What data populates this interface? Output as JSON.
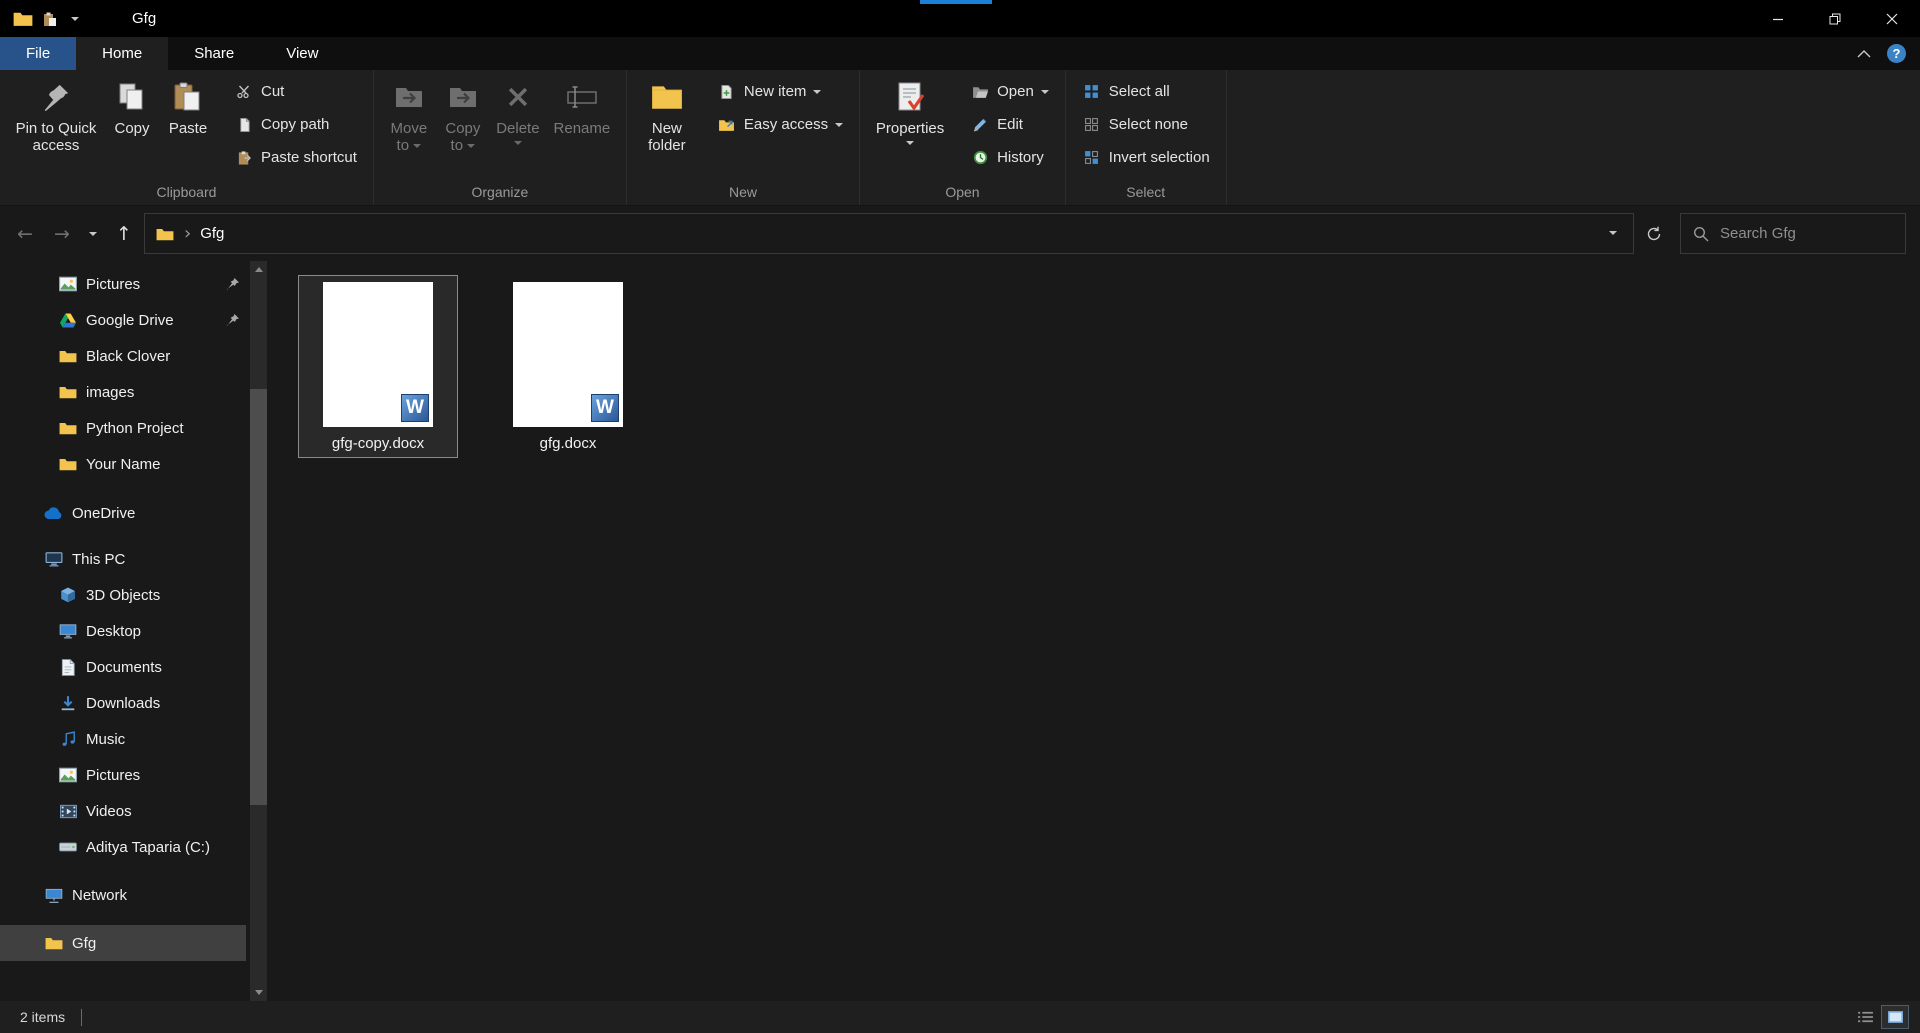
{
  "window": {
    "title": "Gfg"
  },
  "tabs": [
    "File",
    "Home",
    "Share",
    "View"
  ],
  "ribbon": {
    "clipboard": {
      "label": "Clipboard",
      "pin_to_quick_access": "Pin to Quick access",
      "copy": "Copy",
      "paste": "Paste",
      "cut": "Cut",
      "copy_path": "Copy path",
      "paste_shortcut": "Paste shortcut"
    },
    "organize": {
      "label": "Organize",
      "move_to": "Move to",
      "copy_to": "Copy to",
      "delete": "Delete",
      "rename": "Rename"
    },
    "new": {
      "label": "New",
      "new_folder": "New folder",
      "new_item": "New item",
      "easy_access": "Easy access"
    },
    "open": {
      "label": "Open",
      "properties": "Properties",
      "open": "Open",
      "edit": "Edit",
      "history": "History"
    },
    "select": {
      "label": "Select",
      "select_all": "Select all",
      "select_none": "Select none",
      "invert_selection": "Invert selection"
    }
  },
  "address": {
    "path": "Gfg",
    "search_placeholder": "Search Gfg"
  },
  "sidebar": {
    "items": [
      {
        "label": "Pictures",
        "pinned": true
      },
      {
        "label": "Google Drive",
        "pinned": true
      },
      {
        "label": "Black Clover"
      },
      {
        "label": "images"
      },
      {
        "label": "Python Project"
      },
      {
        "label": "Your Name"
      },
      {
        "label": "OneDrive"
      },
      {
        "label": "This PC"
      },
      {
        "label": "3D Objects"
      },
      {
        "label": "Desktop"
      },
      {
        "label": "Documents"
      },
      {
        "label": "Downloads"
      },
      {
        "label": "Music"
      },
      {
        "label": "Pictures"
      },
      {
        "label": "Videos"
      },
      {
        "label": "Aditya Taparia (C:)"
      },
      {
        "label": "Network"
      },
      {
        "label": "Gfg",
        "selected": true
      }
    ]
  },
  "files": [
    {
      "name": "gfg-copy.docx",
      "selected": true
    },
    {
      "name": "gfg.docx",
      "selected": false
    }
  ],
  "status": {
    "items_count": "2 items"
  },
  "icons": {
    "back_arrow": "←",
    "forward_arrow": "→",
    "up_arrow": "↑",
    "breadcrumb_chevron": "›",
    "help_glyph": "?",
    "word_badge": "W"
  },
  "colors": {
    "accent_blue": "#2f7fd6",
    "file_tab_blue": "#27538a",
    "folder_yellow": "#f2c44d",
    "word_blue": "#2b5797",
    "selected_row": "#404040",
    "background": "#191919",
    "ribbon_background": "#1f1f1f",
    "titlebar_background": "#000000"
  }
}
